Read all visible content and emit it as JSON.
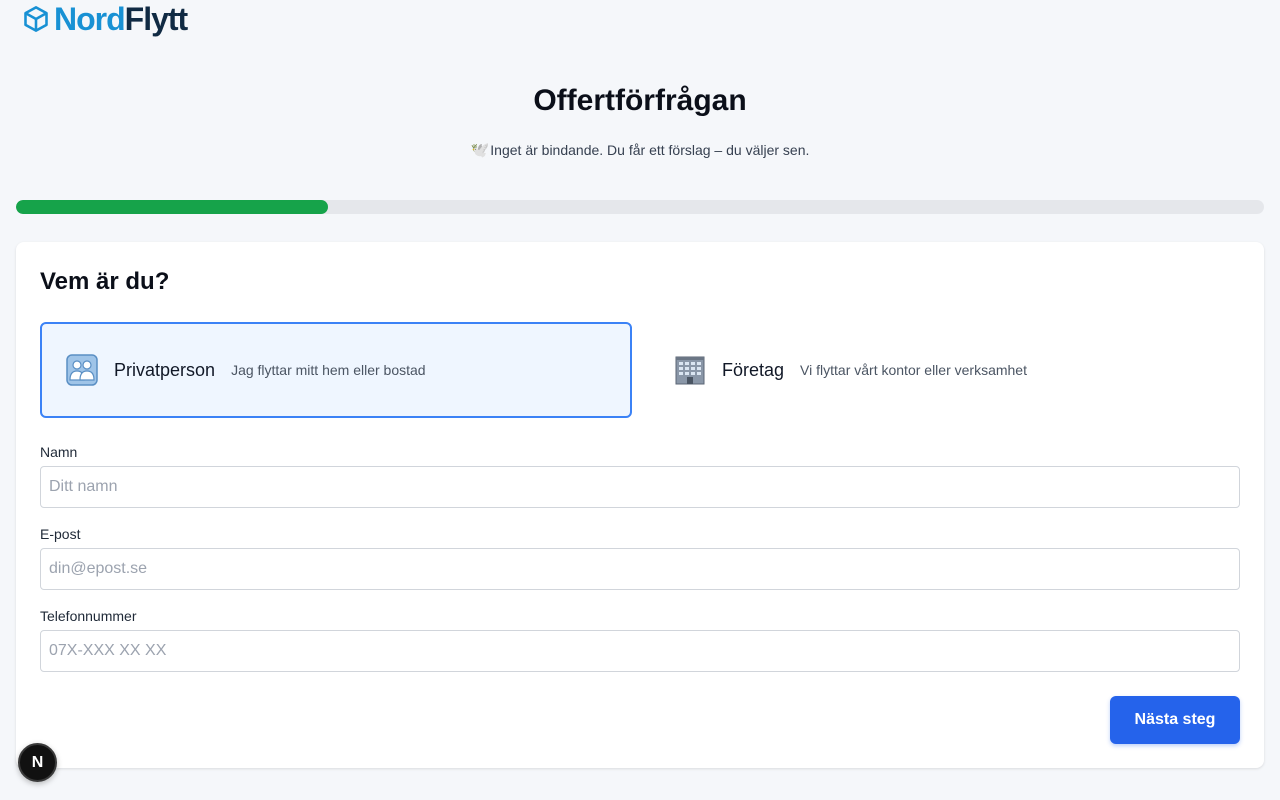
{
  "logo": {
    "part1": "Nord",
    "part2": "Flytt",
    "icon": "box-icon"
  },
  "header": {
    "title": "Offertförfrågan",
    "subtitle_icon": "🕊️",
    "subtitle": "Inget är bindande. Du får ett förslag – du väljer sen."
  },
  "progress": {
    "fraction": 0.25,
    "color": "#16a34a"
  },
  "form": {
    "heading": "Vem är du?",
    "options": [
      {
        "label": "Privatperson",
        "description": "Jag flyttar mitt hem eller bostad",
        "icon": "people-icon",
        "selected": true
      },
      {
        "label": "Företag",
        "description": "Vi flyttar vårt kontor eller verksamhet",
        "icon": "office-building-icon",
        "selected": false
      }
    ],
    "fields": {
      "name": {
        "label": "Namn",
        "placeholder": "Ditt namn",
        "value": ""
      },
      "email": {
        "label": "E-post",
        "placeholder": "din@epost.se",
        "value": ""
      },
      "phone": {
        "label": "Telefonnummer",
        "placeholder": "07X-XXX XX XX",
        "value": ""
      }
    },
    "next_label": "Nästa steg"
  },
  "dev_badge": {
    "letter": "N"
  },
  "colors": {
    "accent": "#2563eb",
    "selected_border": "#3b82f6",
    "selected_bg": "#eff6ff",
    "brand_blue": "#1891d4",
    "brand_dark": "#102a43"
  }
}
